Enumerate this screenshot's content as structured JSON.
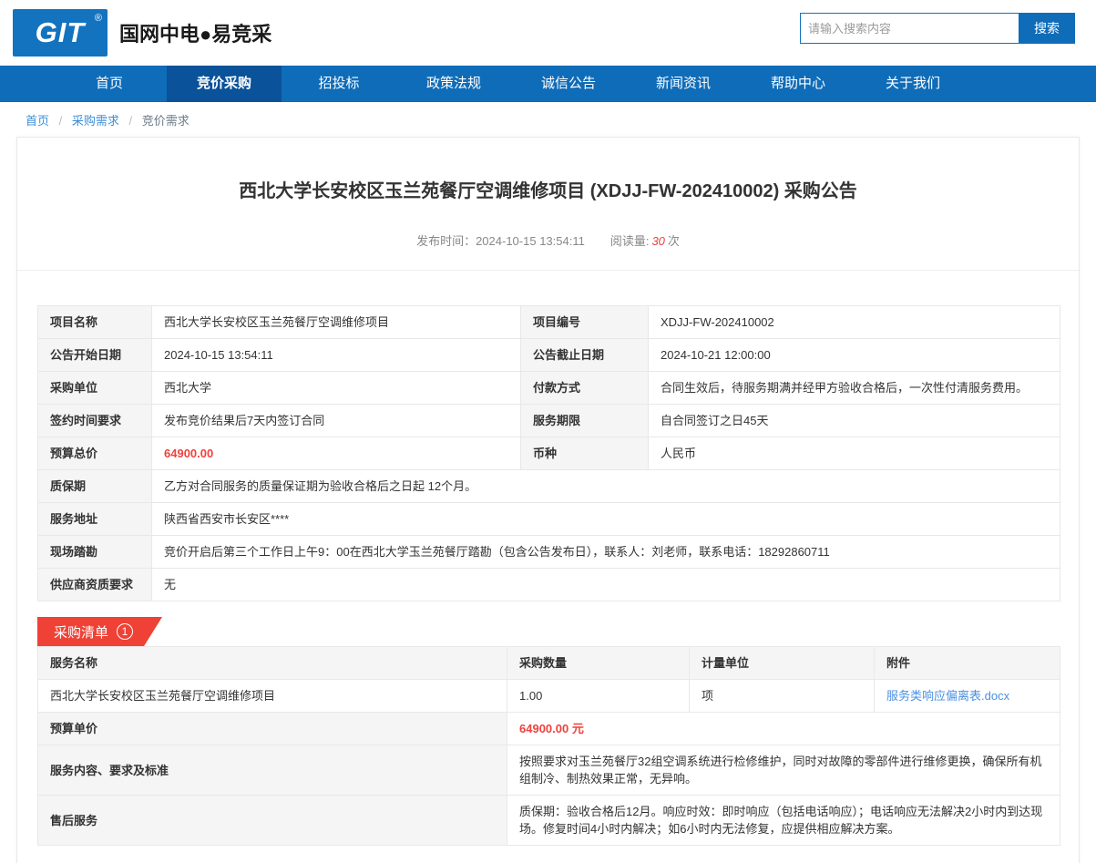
{
  "colors": {
    "primary_blue": "#0f6cb8",
    "active_blue": "#0a5299",
    "accent_red": "#ef4136",
    "link_blue": "#4a90e2"
  },
  "header": {
    "logo_text": "GIT",
    "logo_reg": "®",
    "site_name": "国网中电●易竞采",
    "search_placeholder": "请输入搜索内容",
    "search_button": "搜索"
  },
  "nav": {
    "items": [
      {
        "label": "首页",
        "active": false
      },
      {
        "label": "竞价采购",
        "active": true
      },
      {
        "label": "招投标",
        "active": false
      },
      {
        "label": "政策法规",
        "active": false
      },
      {
        "label": "诚信公告",
        "active": false
      },
      {
        "label": "新闻资讯",
        "active": false
      },
      {
        "label": "帮助中心",
        "active": false
      },
      {
        "label": "关于我们",
        "active": false
      }
    ]
  },
  "breadcrumb": {
    "items": [
      "首页",
      "采购需求",
      "竞价需求"
    ],
    "separator": "/"
  },
  "announcement": {
    "title": "西北大学长安校区玉兰苑餐厅空调维修项目 (XDJJ-FW-202410002) 采购公告",
    "publish_label": "发布时间：",
    "publish_time": "2024-10-15 13:54:11",
    "views_label": "阅读量:",
    "views_count": "30",
    "views_unit": "次"
  },
  "info_table": {
    "paired_rows": [
      {
        "label1": "项目名称",
        "value1": "西北大学长安校区玉兰苑餐厅空调维修项目",
        "label2": "项目编号",
        "value2": "XDJJ-FW-202410002"
      },
      {
        "label1": "公告开始日期",
        "value1": "2024-10-15 13:54:11",
        "label2": "公告截止日期",
        "value2": "2024-10-21 12:00:00"
      },
      {
        "label1": "采购单位",
        "value1": "西北大学",
        "label2": "付款方式",
        "value2": "合同生效后，待服务期满并经甲方验收合格后，一次性付清服务费用。"
      },
      {
        "label1": "签约时间要求",
        "value1": "发布竞价结果后7天内签订合同",
        "label2": "服务期限",
        "value2": "自合同签订之日45天"
      },
      {
        "label1": "预算总价",
        "value1": "64900.00",
        "label2": "币种",
        "value2": "人民币"
      }
    ],
    "full_rows": [
      {
        "label": "质保期",
        "value": "乙方对合同服务的质量保证期为验收合格后之日起 12个月。"
      },
      {
        "label": "服务地址",
        "value": "陕西省西安市长安区****"
      },
      {
        "label": "现场踏勘",
        "value": "竞价开启后第三个工作日上午9：00在西北大学玉兰苑餐厅踏勘（包含公告发布日），联系人：刘老师，联系电话：18292860711"
      },
      {
        "label": "供应商资质要求",
        "value": "无"
      }
    ]
  },
  "purchase_list": {
    "badge_label": "采购清单",
    "badge_count": "1",
    "headers": [
      "服务名称",
      "采购数量",
      "计量单位",
      "附件"
    ],
    "item_row": {
      "name": "西北大学长安校区玉兰苑餐厅空调维修项目",
      "quantity": "1.00",
      "unit": "项",
      "attachment": "服务类响应偏离表.docx"
    },
    "detail_rows": [
      {
        "label": "预算单价",
        "value": "64900.00 元"
      },
      {
        "label": "服务内容、要求及标准",
        "value": "按照要求对玉兰苑餐厅32组空调系统进行检修维护，同时对故障的零部件进行维修更换，确保所有机组制冷、制热效果正常，无异响。"
      },
      {
        "label": "售后服务",
        "value": "质保期：验收合格后12月。响应时效：即时响应（包括电话响应）；电话响应无法解决2小时内到达现场。修复时间4小时内解决；如6小时内无法修复，应提供相应解决方案。"
      }
    ]
  }
}
